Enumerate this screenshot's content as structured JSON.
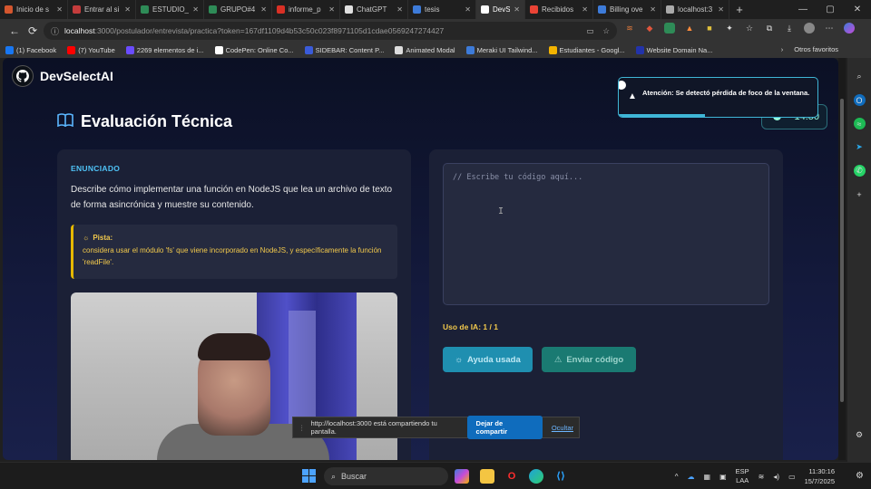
{
  "browser": {
    "tabs": [
      {
        "title": "Inicio de s",
        "color": "#d4562e"
      },
      {
        "title": "Entrar al si",
        "color": "#c43c3c"
      },
      {
        "title": "ESTUDIO_",
        "color": "#2e8b57"
      },
      {
        "title": "GRUPO#4",
        "color": "#2e8b57"
      },
      {
        "title": "informe_p",
        "color": "#d93025"
      },
      {
        "title": "ChatGPT",
        "color": "#e0e0e0"
      },
      {
        "title": "tesis",
        "color": "#3d7bd9"
      },
      {
        "title": "DevS",
        "color": "#ffffff"
      },
      {
        "title": "Recibidos",
        "color": "#ea4335"
      },
      {
        "title": "Billing ove",
        "color": "#3d7bd9"
      },
      {
        "title": "localhost:3",
        "color": "#aaaaaa"
      }
    ],
    "url_host": "localhost",
    "url_path": ":3000/postulador/entrevista/practica?token=167df1109d4b53c50c023f8971105d1cdae0569247274427",
    "bookmarks": [
      {
        "label": "(1) Facebook",
        "color": "#1877f2"
      },
      {
        "label": "(7) YouTube",
        "color": "#ff0000"
      },
      {
        "label": "2269 elementos de i...",
        "color": "#6a4cff"
      },
      {
        "label": "CodePen: Online Co...",
        "color": "#ffffff"
      },
      {
        "label": "SIDEBAR: Content P...",
        "color": "#3a5bd9"
      },
      {
        "label": "Animated Modal",
        "color": "#dddddd"
      },
      {
        "label": "Meraki UI Tailwind...",
        "color": "#3d7bd9"
      },
      {
        "label": "Estudiantes - Googl...",
        "color": "#f4b400"
      },
      {
        "label": "Website Domain Na...",
        "color": "#2233aa"
      }
    ],
    "other_favorites": "Otros favoritos"
  },
  "app": {
    "brand": "DevSelectAI",
    "page_title": "Evaluación Técnica",
    "timer": "14:50",
    "toast": "Atención: Se detectó pérdida de foco de la ventana.",
    "statement_label": "ENUNCIADO",
    "statement": "Describe cómo implementar una función en NodeJS que lea un archivo de texto de forma asincrónica y muestre su contenido.",
    "hint_label": "Pista:",
    "hint_text": "considera usar el módulo 'fs' que viene incorporado en NodeJS, y específicamente la función 'readFile'.",
    "editor_placeholder": "// Escribe tu código aquí...",
    "ai_usage": "Uso de IA: 1 / 1",
    "help_button": "Ayuda usada",
    "send_button": "Enviar código"
  },
  "share_bar": {
    "message": "http://localhost:3000 está compartiendo tu pantalla.",
    "stop": "Dejar de compartir",
    "hide": "Ocultar"
  },
  "taskbar": {
    "search": "Buscar",
    "lang1": "ESP",
    "lang2": "LAA",
    "time": "11:30:16",
    "date": "15/7/2025"
  }
}
